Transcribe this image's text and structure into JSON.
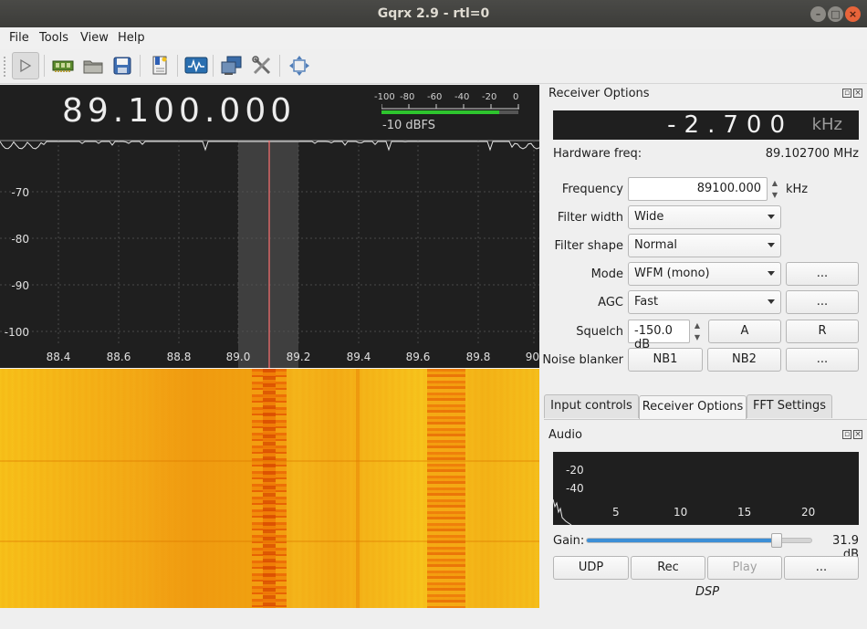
{
  "window": {
    "title": "Gqrx 2.9 - rtl=0"
  },
  "menu": {
    "file": "File",
    "tools": "Tools",
    "view": "View",
    "help": "Help"
  },
  "toolbar": {
    "icons": [
      "play-icon",
      "hardware-icon",
      "folder-open-icon",
      "save-icon",
      "bookmark-icon",
      "signal-display-icon",
      "remote-control-icon",
      "tools-icon",
      "fullscreen-icon"
    ]
  },
  "plotter": {
    "frequency": "89.100.000",
    "meter_ticks": [
      "-100",
      "-80",
      "-60",
      "-40",
      "-20",
      "0"
    ],
    "meter_level": "-10 dBFS",
    "meter_fraction": 0.86,
    "y_labels": [
      "-70",
      "-80",
      "-90",
      "-100"
    ],
    "x_labels": [
      "88.4",
      "88.6",
      "88.8",
      "89.0",
      "89.2",
      "89.4",
      "89.6",
      "89.8",
      "90"
    ]
  },
  "receiver_options": {
    "title": "Receiver Options",
    "offset_value": "-2.700",
    "offset_unit": "kHz",
    "hw_freq_label": "Hardware freq:",
    "hw_freq_value": "89.102700 MHz",
    "frequency_label": "Frequency",
    "frequency_value": "89100.000",
    "frequency_unit": "kHz",
    "filter_width_label": "Filter width",
    "filter_width_value": "Wide",
    "filter_shape_label": "Filter shape",
    "filter_shape_value": "Normal",
    "mode_label": "Mode",
    "mode_value": "WFM (mono)",
    "agc_label": "AGC",
    "agc_value": "Fast",
    "squelch_label": "Squelch",
    "squelch_value": "-150.0 dB",
    "squelch_a": "A",
    "squelch_r": "R",
    "noise_blanker_label": "Noise blanker",
    "nb1": "NB1",
    "nb2": "NB2",
    "more": "..."
  },
  "tabs": [
    {
      "label": "Input controls"
    },
    {
      "label": "Receiver Options"
    },
    {
      "label": "FFT Settings"
    }
  ],
  "audio": {
    "title": "Audio",
    "y_labels": [
      "-20",
      "-40"
    ],
    "x_labels": [
      "5",
      "10",
      "15",
      "20"
    ],
    "gain_label": "Gain:",
    "gain_value": "31.9 dB",
    "gain_fraction": 0.84,
    "udp": "UDP",
    "rec": "Rec",
    "play": "Play",
    "more": "...",
    "dsp": "DSP"
  }
}
